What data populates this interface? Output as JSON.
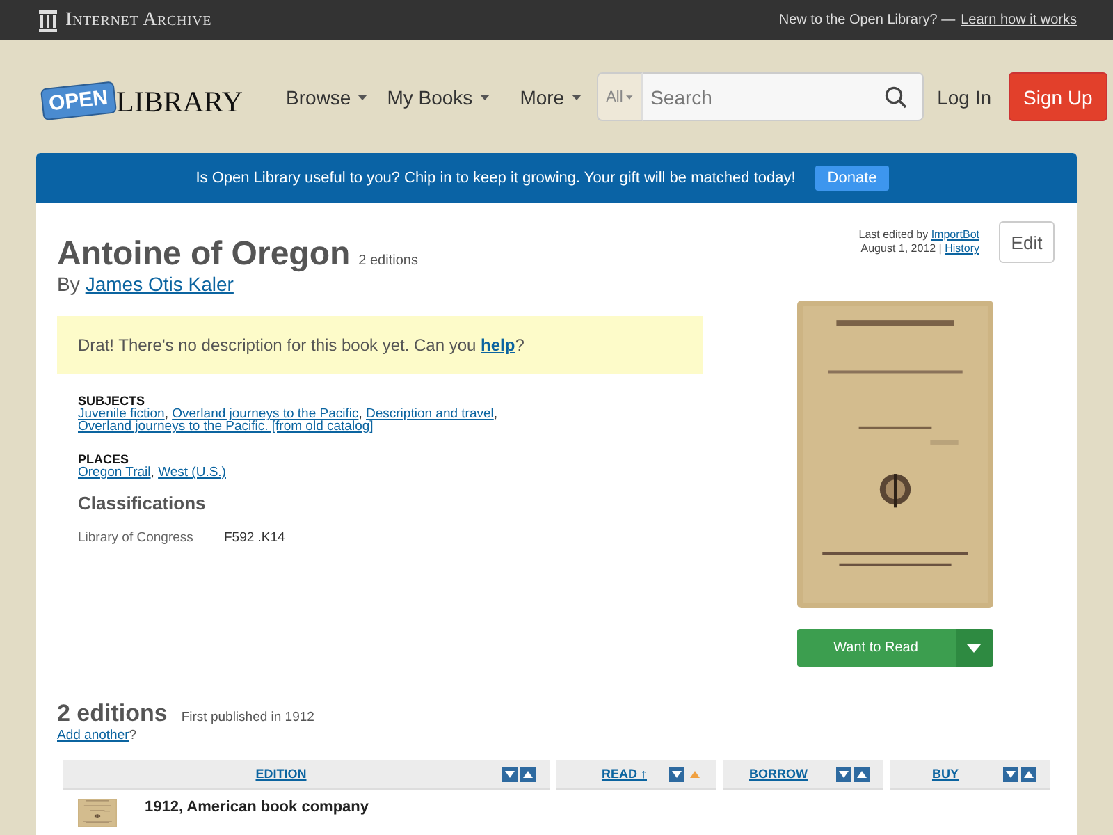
{
  "top_bar": {
    "brand": "Internet Archive",
    "prompt": "New to the Open Library? —",
    "link": "Learn how it works"
  },
  "header": {
    "logo_badge": "OPEN",
    "logo_text": "LIBRARY",
    "nav": [
      {
        "label": "Browse"
      },
      {
        "label": "My Books"
      },
      {
        "label": "More"
      }
    ],
    "search": {
      "scope": "All",
      "placeholder": "Search"
    },
    "login": "Log In",
    "signup": "Sign Up"
  },
  "banner": {
    "message": "Is Open Library useful to you? Chip in to keep it growing. Your gift will be matched today!",
    "button": "Donate"
  },
  "work": {
    "title": "Antoine of Oregon",
    "editions_count": "2 editions",
    "by": "By",
    "author": "James Otis Kaler",
    "last_edited": {
      "prefix": "Last edited by",
      "user": "ImportBot",
      "date": "August 1, 2012 |",
      "history": "History"
    },
    "edit_button": "Edit",
    "description": {
      "text": "Drat! There's no description for this book yet. Can you",
      "link": "help",
      "suffix": "?"
    },
    "separator": ", ",
    "subjects": {
      "heading": "SUBJECTS",
      "items": [
        "Juvenile fiction",
        "Overland journeys to the Pacific",
        "Description and travel",
        "Overland journeys to the Pacific. [from old catalog]"
      ]
    },
    "places": {
      "heading": "PLACES",
      "items": [
        "Oregon Trail",
        "West (U.S.)"
      ]
    },
    "classifications": {
      "heading": "Classifications",
      "rows": [
        {
          "label": "Library of Congress",
          "value": "F592 .K14"
        }
      ]
    },
    "want_to_read": "Want to Read"
  },
  "editions": {
    "heading": "2 editions",
    "note": "First published in 1912",
    "add_link": "Add another",
    "add_suffix": "?",
    "columns": [
      {
        "label": "EDITION",
        "sorted": false
      },
      {
        "label": "READ ↑",
        "sorted": true
      },
      {
        "label": "BORROW",
        "sorted": false
      },
      {
        "label": "BUY",
        "sorted": false
      }
    ],
    "rows": [
      {
        "title": "1912, American book company"
      }
    ]
  }
}
